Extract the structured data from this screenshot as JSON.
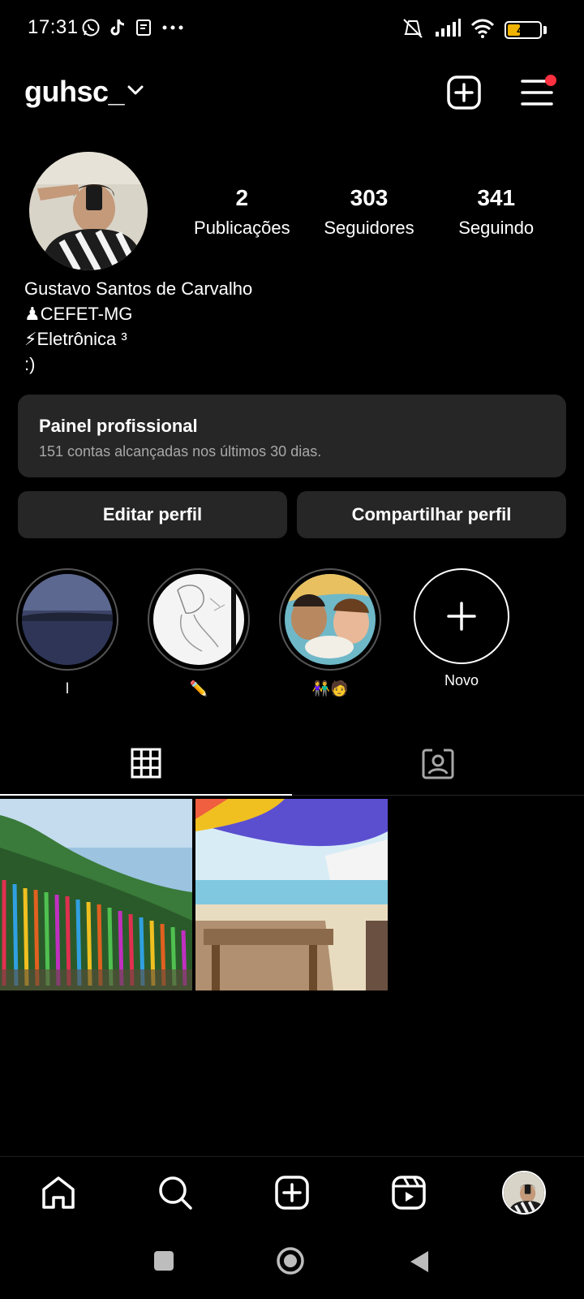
{
  "status_bar": {
    "time": "17:31",
    "battery_level": "40",
    "battery_fraction": 0.4,
    "left_icons": [
      "whatsapp-icon",
      "tiktok-icon",
      "clipboard-icon",
      "more-dots-icon"
    ],
    "right_icons": [
      "vibrate-off-icon",
      "signal-icon",
      "wifi-icon",
      "battery-icon"
    ]
  },
  "header": {
    "username": "guhsc_",
    "accent_red": "#ff3040"
  },
  "profile": {
    "stats": [
      {
        "value": "2",
        "label": "Publicações"
      },
      {
        "value": "303",
        "label": "Seguidores"
      },
      {
        "value": "341",
        "label": "Seguindo"
      }
    ],
    "name": "Gustavo Santos de Carvalho",
    "bio_lines": [
      "♟CEFET-MG",
      "⚡Eletrônica ³",
      ":)"
    ]
  },
  "dashboard": {
    "title": "Painel profissional",
    "subtitle": "151 contas alcançadas nos últimos 30 dias."
  },
  "actions": {
    "edit_label": "Editar perfil",
    "share_label": "Compartilhar perfil"
  },
  "highlights": [
    {
      "label": "l"
    },
    {
      "label": "✏️"
    },
    {
      "label": "👫🧑"
    },
    {
      "label": "Novo"
    }
  ],
  "tabs": [
    "grid-icon",
    "tagged-icon"
  ],
  "bottom_nav": [
    "home-icon",
    "search-icon",
    "create-icon",
    "reels-icon",
    "profile-avatar"
  ]
}
